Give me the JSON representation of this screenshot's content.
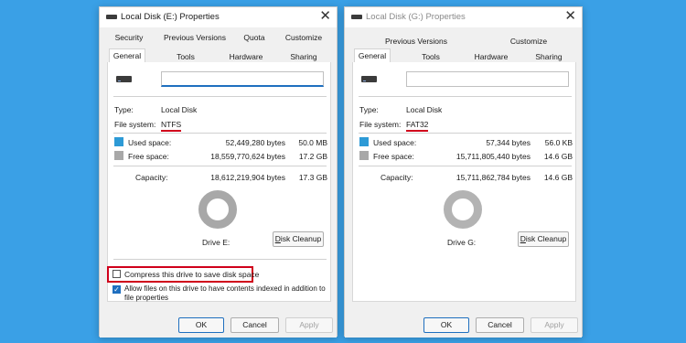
{
  "left": {
    "title": "Local Disk (E:) Properties",
    "tabs_row1": [
      "Security",
      "Previous Versions",
      "Quota",
      "Customize"
    ],
    "tabs_row2": [
      "General",
      "Tools",
      "Hardware",
      "Sharing"
    ],
    "type_label": "Type:",
    "type_value": "Local Disk",
    "fs_label": "File system:",
    "fs_value": "NTFS",
    "used_label": "Used space:",
    "used_bytes": "52,449,280 bytes",
    "used_size": "50.0 MB",
    "free_label": "Free space:",
    "free_bytes": "18,559,770,624 bytes",
    "free_size": "17.2 GB",
    "capacity_label": "Capacity:",
    "capacity_bytes": "18,612,219,904 bytes",
    "capacity_size": "17.3 GB",
    "drive_label": "Drive E:",
    "cleanup_label": "Disk Cleanup",
    "compress_label": "Compress this drive to save disk space",
    "compress_checked": false,
    "index_label_line1": "Allow files on this drive to have contents indexed in addition to",
    "index_label_line2": "file properties",
    "index_checked": true,
    "ok": "OK",
    "cancel": "Cancel",
    "apply": "Apply",
    "used_fraction": 0.003
  },
  "right": {
    "title": "Local Disk (G:) Properties",
    "tabs_row1": [
      "Previous Versions",
      "Customize"
    ],
    "tabs_row2": [
      "General",
      "Tools",
      "Hardware",
      "Sharing"
    ],
    "type_label": "Type:",
    "type_value": "Local Disk",
    "fs_label": "File system:",
    "fs_value": "FAT32",
    "used_label": "Used space:",
    "used_bytes": "57,344 bytes",
    "used_size": "56.0 KB",
    "free_label": "Free space:",
    "free_bytes": "15,711,805,440 bytes",
    "free_size": "14.6 GB",
    "capacity_label": "Capacity:",
    "capacity_bytes": "15,711,862,784 bytes",
    "capacity_size": "14.6 GB",
    "drive_label": "Drive G:",
    "cleanup_label": "Disk Cleanup",
    "ok": "OK",
    "cancel": "Cancel",
    "apply": "Apply",
    "used_fraction": 0.0
  },
  "colors": {
    "background": "#3aa0e6",
    "used": "#2d9ad6",
    "free": "#a8a8a8",
    "highlight": "#d0001b"
  }
}
